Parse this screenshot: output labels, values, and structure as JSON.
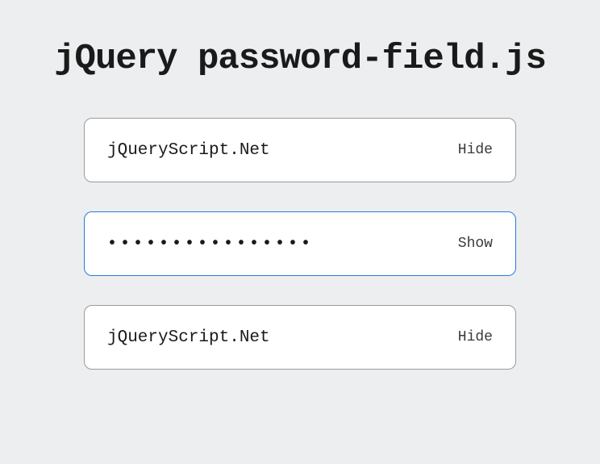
{
  "title": "jQuery password-field.js",
  "fields": [
    {
      "value": "jQueryScript.Net",
      "masked": false,
      "toggle_label": "Hide",
      "focused": false
    },
    {
      "value": "jQueryScript.Net",
      "masked_display": "••••••••••••••••",
      "masked": true,
      "toggle_label": "Show",
      "focused": true
    },
    {
      "value": "jQueryScript.Net",
      "masked": false,
      "toggle_label": "Hide",
      "focused": false
    }
  ]
}
